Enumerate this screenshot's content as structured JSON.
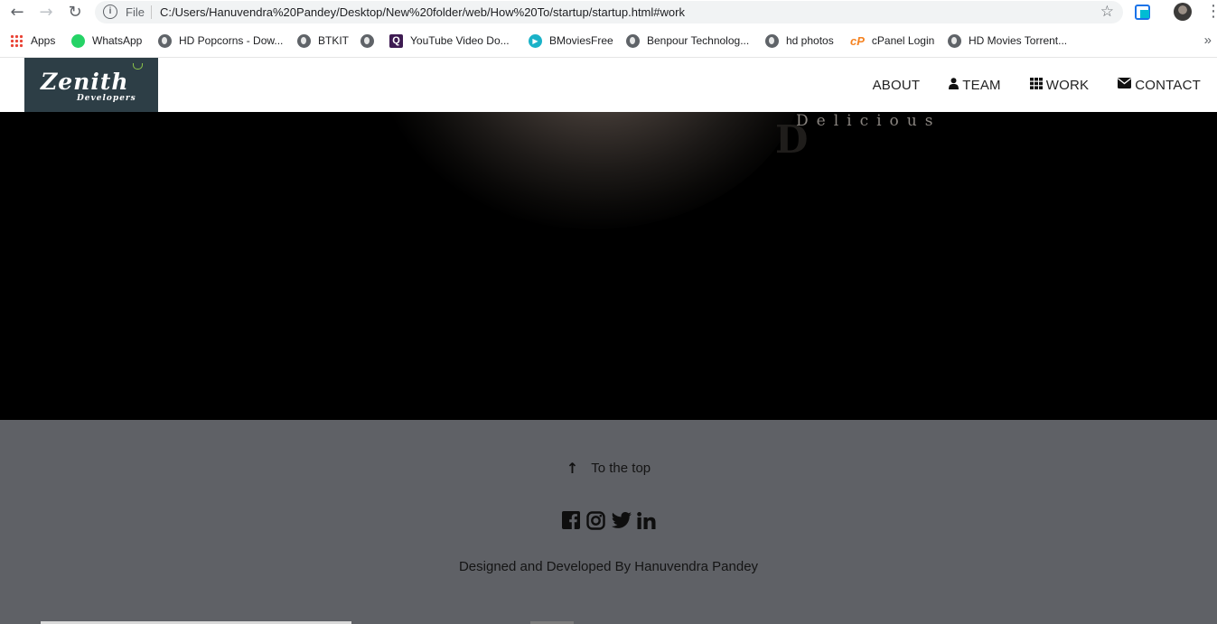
{
  "browser": {
    "omnibox_scheme": "File",
    "url": "C:/Users/Hanuvendra%20Pandey/Desktop/New%20folder/web/How%20To/startup/startup.html#work"
  },
  "bookmarks": [
    {
      "label": "Apps",
      "icon": "apps-grid-icon"
    },
    {
      "label": "WhatsApp",
      "icon": "whatsapp-icon"
    },
    {
      "label": "HD Popcorns - Dow...",
      "icon": "globe-icon"
    },
    {
      "label": "BTKIT",
      "icon": "globe-icon"
    },
    {
      "label": "",
      "icon": "globe-icon"
    },
    {
      "label": "YouTube Video Do...",
      "icon": "q-icon"
    },
    {
      "label": "BMoviesFree",
      "icon": "play-icon"
    },
    {
      "label": "Benpour Technolog...",
      "icon": "globe-icon"
    },
    {
      "label": "hd photos",
      "icon": "globe-icon"
    },
    {
      "label": "cPanel Login",
      "icon": "cpanel-icon"
    },
    {
      "label": "HD Movies Torrent...",
      "icon": "globe-icon"
    }
  ],
  "site": {
    "logo_title": "Zenith",
    "logo_subtitle": "Developers",
    "nav": [
      {
        "label": "ABOUT",
        "icon": ""
      },
      {
        "label": "TEAM",
        "icon": "user-icon"
      },
      {
        "label": "WORK",
        "icon": "grid-icon"
      },
      {
        "label": "CONTACT",
        "icon": "envelope-icon"
      }
    ]
  },
  "hero": {
    "text": "Delicious"
  },
  "footer": {
    "to_top": "To the top",
    "socials": [
      "facebook-icon",
      "instagram-icon",
      "twitter-icon",
      "linkedin-icon"
    ],
    "credit": "Designed and Developed By Hanuvendra Pandey"
  }
}
